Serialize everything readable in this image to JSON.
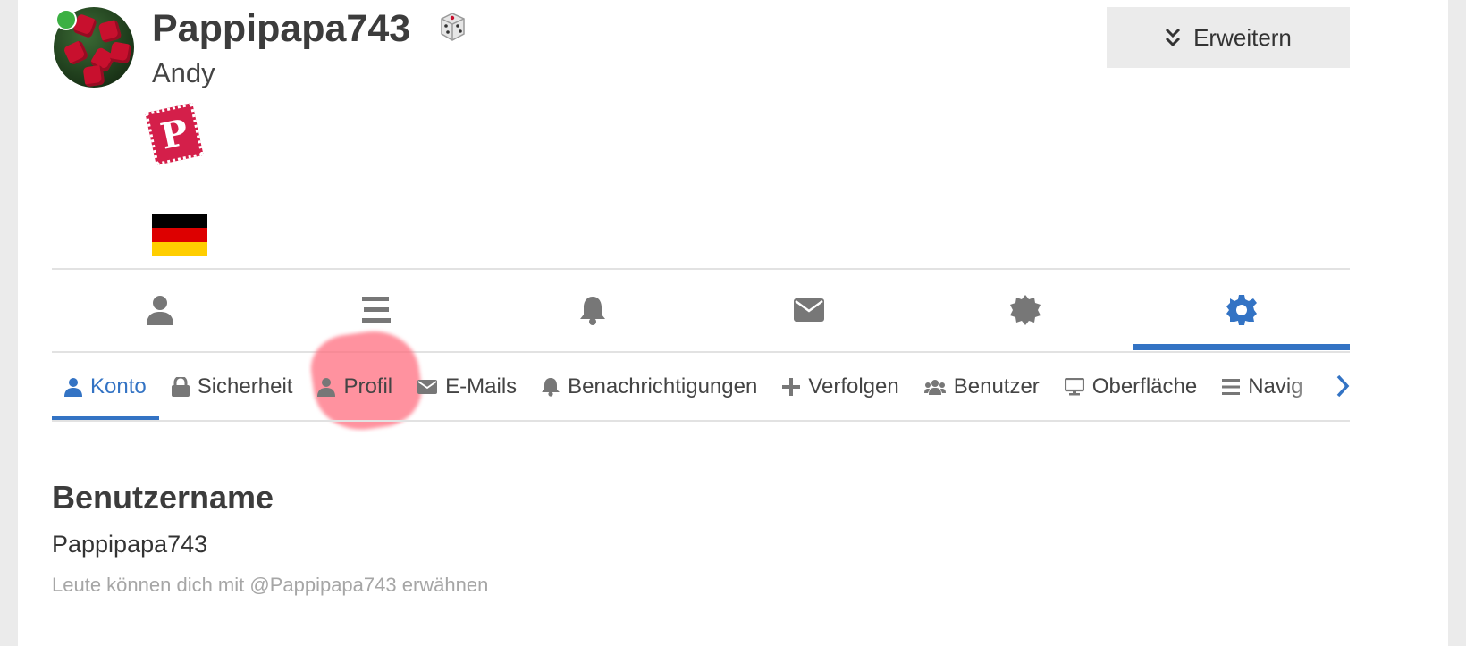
{
  "profile": {
    "username": "Pappipapa743",
    "real_name": "Andy",
    "badge_letter": "P"
  },
  "header": {
    "expand_label": "Erweitern"
  },
  "main_tabs": [
    {
      "icon": "user-icon",
      "active": false
    },
    {
      "icon": "list-icon",
      "active": false
    },
    {
      "icon": "bell-icon",
      "active": false
    },
    {
      "icon": "envelope-icon",
      "active": false
    },
    {
      "icon": "badge-gear-icon",
      "active": false
    },
    {
      "icon": "settings-gear-icon",
      "active": true
    }
  ],
  "sub_tabs": [
    {
      "label": "Konto",
      "icon": "user-icon",
      "active": true
    },
    {
      "label": "Sicherheit",
      "icon": "lock-icon",
      "active": false
    },
    {
      "label": "Profil",
      "icon": "user-icon",
      "active": false
    },
    {
      "label": "E-Mails",
      "icon": "envelope-icon",
      "active": false
    },
    {
      "label": "Benachrichtigungen",
      "icon": "bell-icon",
      "active": false
    },
    {
      "label": "Verfolgen",
      "icon": "plus-icon",
      "active": false
    },
    {
      "label": "Benutzer",
      "icon": "users-icon",
      "active": false
    },
    {
      "label": "Oberfläche",
      "icon": "monitor-icon",
      "active": false
    },
    {
      "label": "Navig",
      "icon": "list-icon",
      "active": false
    }
  ],
  "section": {
    "title": "Benutzername",
    "value": "Pappipapa743",
    "hint": "Leute können dich mit @Pappipapa743 erwähnen"
  },
  "colors": {
    "accent": "#3373c4",
    "online": "#3cb043",
    "stamp": "#d41f4a",
    "highlight": "#ff6e7f"
  }
}
